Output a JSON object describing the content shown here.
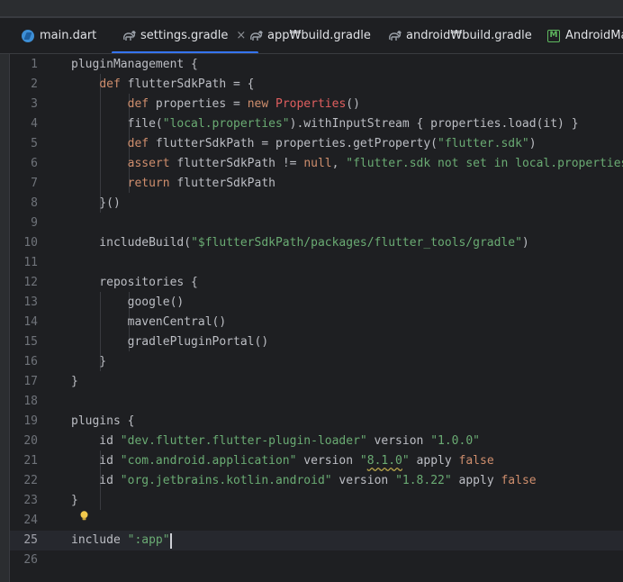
{
  "tabs": [
    {
      "label": "main.dart",
      "icon": "dart-file-icon",
      "active": false
    },
    {
      "label": "settings.gradle",
      "icon": "gradle-elephant-icon",
      "active": true
    },
    {
      "label": "app₩build.gradle",
      "icon": "gradle-elephant-icon",
      "active": false
    },
    {
      "label": "android₩build.gradle",
      "icon": "gradle-elephant-icon",
      "active": false
    },
    {
      "label": "AndroidManifest.xml",
      "icon": "manifest-icon",
      "active": false
    }
  ],
  "close_glyph": "×",
  "editor": {
    "current_line": 25,
    "line_numbers": [
      "1",
      "2",
      "3",
      "4",
      "5",
      "6",
      "7",
      "8",
      "9",
      "10",
      "11",
      "12",
      "13",
      "14",
      "15",
      "16",
      "17",
      "18",
      "19",
      "20",
      "21",
      "22",
      "23",
      "24",
      "25",
      "26"
    ],
    "lines": [
      [
        [
          "t",
          "pluginManagement {"
        ]
      ],
      [
        [
          "t",
          "    "
        ],
        [
          "kw",
          "def"
        ],
        [
          "t",
          " flutterSdkPath = {"
        ]
      ],
      [
        [
          "t",
          "        "
        ],
        [
          "kw",
          "def"
        ],
        [
          "t",
          " properties = "
        ],
        [
          "kw",
          "new"
        ],
        [
          "t",
          " "
        ],
        [
          "cls",
          "Properties"
        ],
        [
          "t",
          "()"
        ]
      ],
      [
        [
          "t",
          "        file("
        ],
        [
          "str",
          "\"local.properties\""
        ],
        [
          "t",
          ").withInputStream { properties.load(it) }"
        ]
      ],
      [
        [
          "t",
          "        "
        ],
        [
          "kw",
          "def"
        ],
        [
          "t",
          " flutterSdkPath = properties.getProperty("
        ],
        [
          "str",
          "\"flutter.sdk\""
        ],
        [
          "t",
          ")"
        ]
      ],
      [
        [
          "t",
          "        "
        ],
        [
          "kw",
          "assert"
        ],
        [
          "t",
          " flutterSdkPath != "
        ],
        [
          "kw",
          "null"
        ],
        [
          "t",
          ", "
        ],
        [
          "str",
          "\"flutter.sdk not set in local.properties\""
        ]
      ],
      [
        [
          "t",
          "        "
        ],
        [
          "kw",
          "return"
        ],
        [
          "t",
          " flutterSdkPath"
        ]
      ],
      [
        [
          "t",
          "    }()"
        ]
      ],
      [
        [
          "t",
          ""
        ]
      ],
      [
        [
          "t",
          "    includeBuild("
        ],
        [
          "str",
          "\"$flutterSdkPath/packages/flutter_tools/gradle\""
        ],
        [
          "t",
          ")"
        ]
      ],
      [
        [
          "t",
          ""
        ]
      ],
      [
        [
          "t",
          "    repositories {"
        ]
      ],
      [
        [
          "t",
          "        google()"
        ]
      ],
      [
        [
          "t",
          "        mavenCentral()"
        ]
      ],
      [
        [
          "t",
          "        gradlePluginPortal()"
        ]
      ],
      [
        [
          "t",
          "    }"
        ]
      ],
      [
        [
          "t",
          "}"
        ]
      ],
      [
        [
          "t",
          ""
        ]
      ],
      [
        [
          "t",
          "plugins {"
        ]
      ],
      [
        [
          "t",
          "    id "
        ],
        [
          "str",
          "\"dev.flutter.flutter-plugin-loader\""
        ],
        [
          "t",
          " version "
        ],
        [
          "str",
          "\"1.0.0\""
        ]
      ],
      [
        [
          "t",
          "    id "
        ],
        [
          "str",
          "\"com.android.application\""
        ],
        [
          "t",
          " version "
        ],
        [
          "str",
          "\""
        ],
        [
          "strul",
          "8.1.0"
        ],
        [
          "str",
          "\""
        ],
        [
          "t",
          " apply "
        ],
        [
          "kw",
          "false"
        ]
      ],
      [
        [
          "t",
          "    id "
        ],
        [
          "str",
          "\"org.jetbrains.kotlin.android\""
        ],
        [
          "t",
          " version "
        ],
        [
          "str",
          "\"1.8.22\""
        ],
        [
          "t",
          " apply "
        ],
        [
          "kw",
          "false"
        ]
      ],
      [
        [
          "t",
          "}"
        ]
      ],
      [
        [
          "t",
          ""
        ]
      ],
      [
        [
          "t",
          "include "
        ],
        [
          "str",
          "\":app\""
        ]
      ],
      [
        [
          "t",
          ""
        ]
      ]
    ]
  },
  "colors": {
    "background": "#1e1f22",
    "keyword": "#cf8e6d",
    "string": "#6aab73",
    "class": "#e05f5f",
    "plain": "#bcbec4",
    "accent": "#3574f0"
  }
}
